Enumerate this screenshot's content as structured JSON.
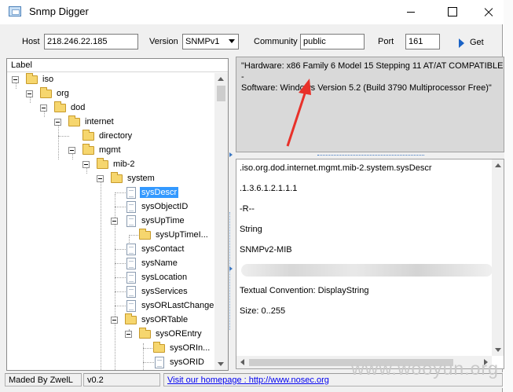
{
  "window": {
    "title": "Snmp Digger",
    "controls": {
      "minimize": "minimize",
      "maximize": "maximize",
      "close": "close"
    }
  },
  "toolbar": {
    "host_label": "Host",
    "host_value": "218.246.22.185",
    "version_label": "Version",
    "version_value": "SNMPv1",
    "community_label": "Community",
    "community_value": "public",
    "port_label": "Port",
    "port_value": "161",
    "get_label": "Get"
  },
  "tree": {
    "header": "Label",
    "nodes": [
      {
        "label": "iso",
        "icon": "folder-icon"
      },
      {
        "label": "org",
        "icon": "folder-icon"
      },
      {
        "label": "dod",
        "icon": "folder-icon"
      },
      {
        "label": "internet",
        "icon": "folder-icon"
      },
      {
        "label": "directory",
        "icon": "folder-icon"
      },
      {
        "label": "mgmt",
        "icon": "folder-icon"
      },
      {
        "label": "mib-2",
        "icon": "folder-icon"
      },
      {
        "label": "system",
        "icon": "folder-icon"
      },
      {
        "label": "sysDescr",
        "icon": "document-icon",
        "selected": true
      },
      {
        "label": "sysObjectID",
        "icon": "document-icon"
      },
      {
        "label": "sysUpTime",
        "icon": "document-icon"
      },
      {
        "label": "sysUpTimeI...",
        "icon": "folder-icon"
      },
      {
        "label": "sysContact",
        "icon": "document-icon"
      },
      {
        "label": "sysName",
        "icon": "document-icon"
      },
      {
        "label": "sysLocation",
        "icon": "document-icon"
      },
      {
        "label": "sysServices",
        "icon": "document-icon"
      },
      {
        "label": "sysORLastChange",
        "icon": "document-icon"
      },
      {
        "label": "sysORTable",
        "icon": "folder-icon"
      },
      {
        "label": "sysOREntry",
        "icon": "folder-icon"
      },
      {
        "label": "sysORIn...",
        "icon": "folder-icon"
      },
      {
        "label": "sysORID",
        "icon": "document-icon"
      }
    ]
  },
  "result": {
    "line1": "\"Hardware: x86 Family 6 Model 15 Stepping 11 AT/AT COMPATIBLE -",
    "line2": "Software: Windows Version 5.2 (Build 3790 Multiprocessor Free)\""
  },
  "detail": {
    "oid_path": ".iso.org.dod.internet.mgmt.mib-2.system.sysDescr",
    "oid_numeric": ".1.3.6.1.2.1.1.1",
    "access": "-R--",
    "type": "String",
    "module": "SNMPv2-MIB",
    "convention": "Textual Convention: DisplayString",
    "size": "Size: 0..255"
  },
  "status": {
    "author": "Maded By ZwelL",
    "version": "v0.2",
    "homepage": "Visit our homepage :  http://www.nosec.org"
  },
  "watermark": "www.wooyun.org",
  "colors": {
    "selection": "#3399ff",
    "annotation_arrow": "#e8312a",
    "link": "#0000ee",
    "result_bg": "#d9d9d9"
  }
}
